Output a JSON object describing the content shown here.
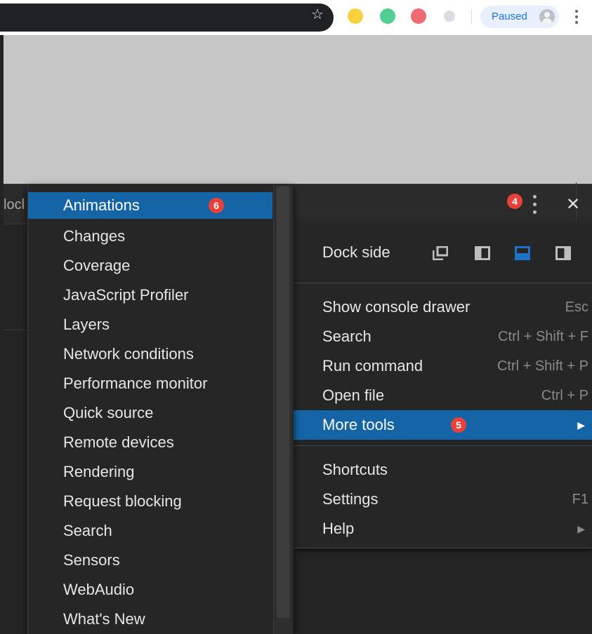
{
  "browser": {
    "profile_status": "Paused"
  },
  "devtools": {
    "tab_clip": "locl"
  },
  "badges": {
    "menu_button": "4",
    "more_tools": "5",
    "animations": "6"
  },
  "main_menu": {
    "dock_side_label": "Dock side",
    "dock_selected": "bottom",
    "items": [
      {
        "label": "Show console drawer",
        "shortcut": "Esc"
      },
      {
        "label": "Search",
        "shortcut": "Ctrl + Shift + F"
      },
      {
        "label": "Run command",
        "shortcut": "Ctrl + Shift + P"
      },
      {
        "label": "Open file",
        "shortcut": "Ctrl + P"
      },
      {
        "label": "More tools",
        "shortcut": ""
      },
      {
        "label": "Shortcuts",
        "shortcut": ""
      },
      {
        "label": "Settings",
        "shortcut": "F1"
      },
      {
        "label": "Help",
        "shortcut": ""
      }
    ]
  },
  "more_tools_submenu": {
    "items": [
      "Animations",
      "Changes",
      "Coverage",
      "JavaScript Profiler",
      "Layers",
      "Network conditions",
      "Performance monitor",
      "Quick source",
      "Remote devices",
      "Rendering",
      "Request blocking",
      "Search",
      "Sensors",
      "WebAudio",
      "What's New"
    ]
  },
  "colors": {
    "highlight": "#1565a6",
    "menu_bg": "#262626",
    "badge": "#e8413a"
  }
}
